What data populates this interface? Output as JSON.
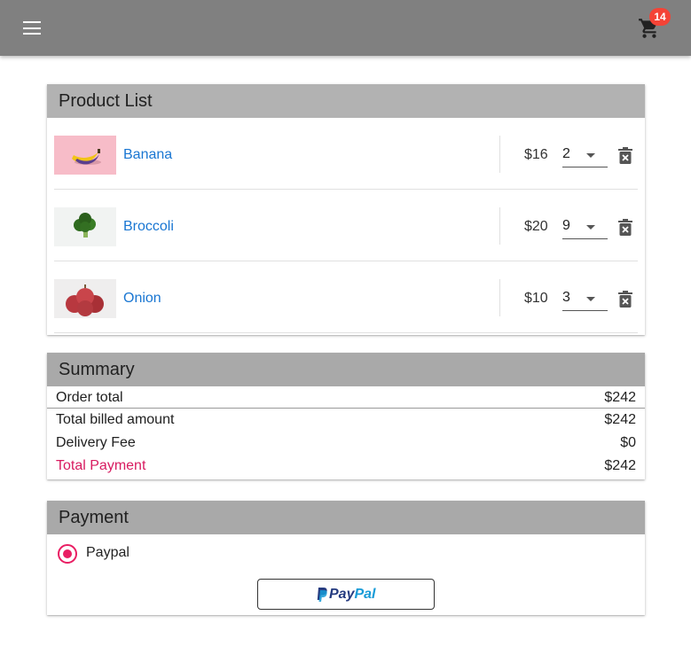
{
  "header": {
    "cart_count": "14",
    "menu_icon": "menu-icon",
    "cart_icon": "shopping-cart-icon"
  },
  "products": {
    "title": "Product List",
    "items": [
      {
        "name": "Banana",
        "price": "$16",
        "qty": "2"
      },
      {
        "name": "Broccoli",
        "price": "$20",
        "qty": "9"
      },
      {
        "name": "Onion",
        "price": "$10",
        "qty": "3"
      }
    ]
  },
  "summary": {
    "title": "Summary",
    "order_total_label": "Order total",
    "order_total": "$242",
    "billed_label": "Total billed amount",
    "billed": "$242",
    "delivery_label": "Delivery Fee",
    "delivery": "$0",
    "payment_label": "Total Payment",
    "payment": "$242"
  },
  "payment": {
    "title": "Payment",
    "option": "Paypal",
    "button_pay": "Pay",
    "button_pal": "Pal"
  },
  "colors": {
    "appbar": "#808080",
    "badge": "#f44336",
    "link": "#1976d2",
    "accent": "#e91e63",
    "paypal_dark": "#253b80",
    "paypal_light": "#179bd7"
  }
}
